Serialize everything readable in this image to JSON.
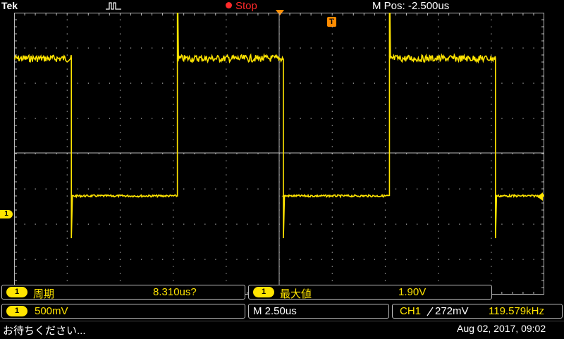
{
  "header": {
    "brand": "Tek",
    "run_state": "Stop",
    "horizontal_position": "M Pos: -2.500us"
  },
  "markers": {
    "trigger_label": "T",
    "channel_label": "1"
  },
  "measurements": [
    {
      "channel": "1",
      "name": "周期",
      "value": "8.310us?"
    },
    {
      "channel": "1",
      "name": "最大値",
      "value": "1.90V"
    }
  ],
  "settings": {
    "channel": "1",
    "volts_per_div": "500mV",
    "time_per_div": "M 2.50us",
    "trigger_source": "CH1",
    "trigger_slope_icon": "rising-edge-icon",
    "trigger_level": "272mV",
    "trigger_frequency": "119.579kHz"
  },
  "status_bar": {
    "message": "お待ちください...",
    "timestamp": "Aug 02, 2017, 09:02"
  },
  "colors": {
    "channel1": "#ffe400",
    "stop": "#ff2a2a",
    "trigger": "#ff8c00",
    "grid": "#b9b9b9"
  },
  "chart_data": {
    "type": "line",
    "series": [
      {
        "x": [
          0,
          5.4,
          5.4,
          15.4,
          15.4,
          25.4,
          25.4,
          35.4,
          35.4,
          45.4,
          45.4,
          50
        ],
        "y": [
          1.35,
          1.35,
          -0.6,
          -0.6,
          1.35,
          1.35,
          -0.6,
          -0.6,
          1.35,
          1.35,
          -0.6,
          -0.6
        ]
      }
    ],
    "xlim": [
      0,
      50
    ],
    "ylim": [
      -2.0,
      2.0
    ],
    "grid": true
  }
}
